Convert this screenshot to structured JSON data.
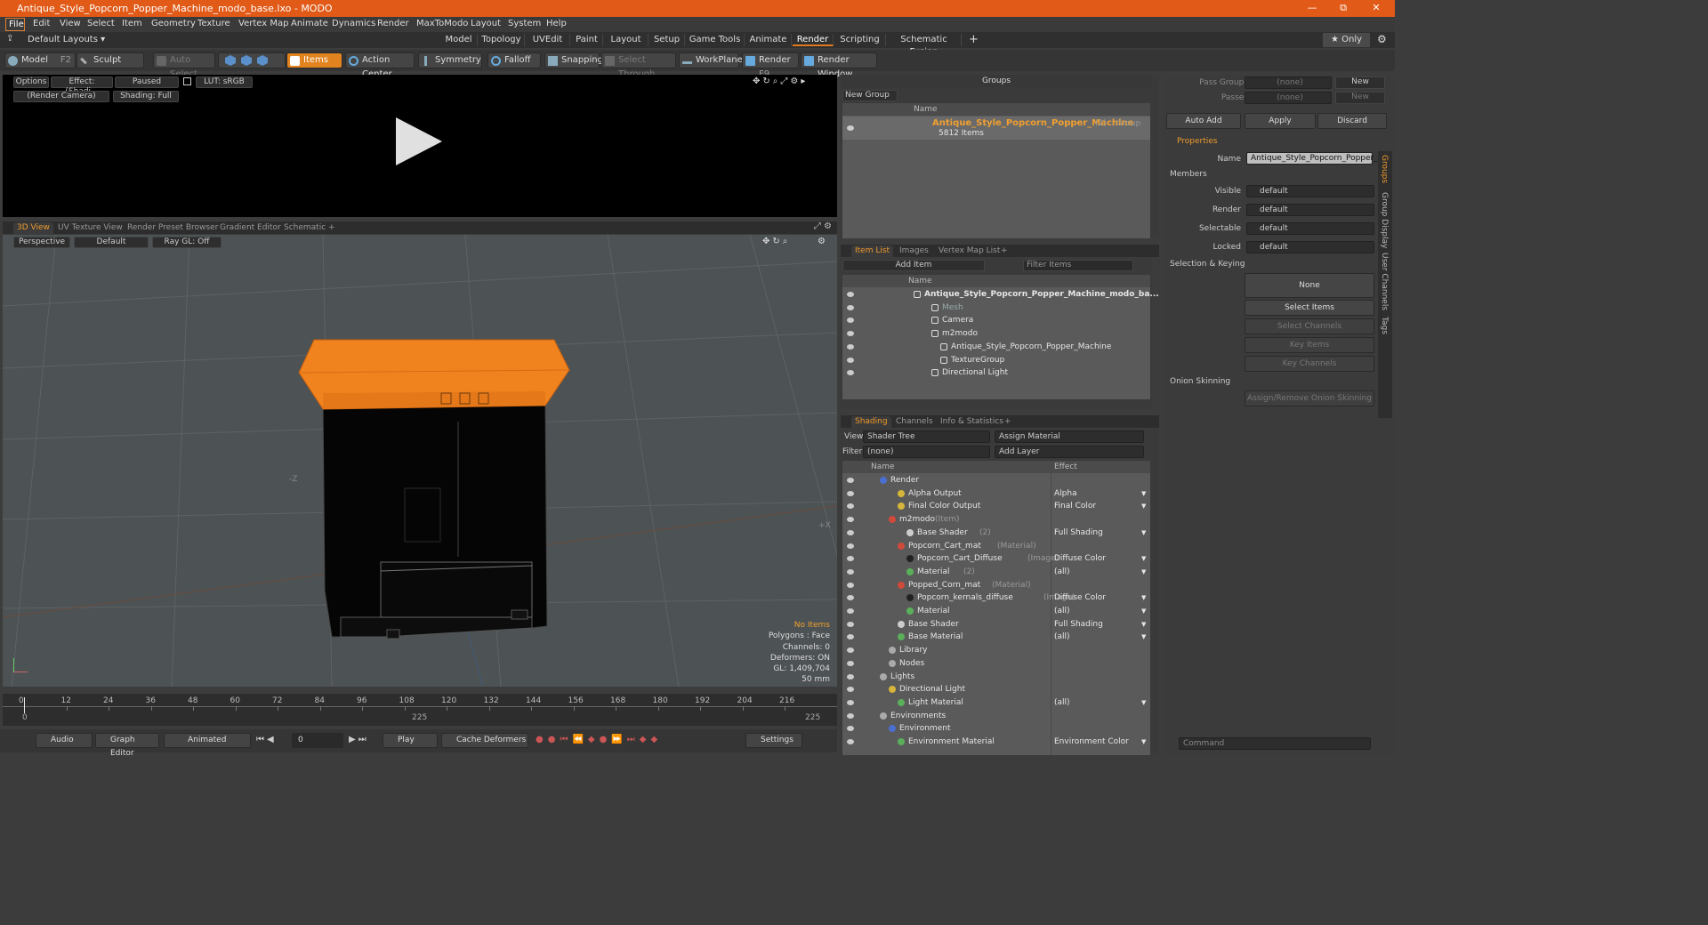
{
  "window": {
    "title": "Antique_Style_Popcorn_Popper_Machine_modo_base.lxo - MODO",
    "controls": [
      "—",
      "⧉",
      "✕"
    ]
  },
  "menu": [
    "File",
    "Edit",
    "View",
    "Select",
    "Item",
    "Geometry",
    "Texture",
    "Vertex Map",
    "Animate",
    "Dynamics",
    "Render",
    "MaxToModo",
    "Layout",
    "System",
    "Help"
  ],
  "layouts": {
    "dropdown": "Default Layouts ▾",
    "tabs": [
      "Model",
      "Topology",
      "UVEdit",
      "Paint",
      "Layout",
      "Setup",
      "Game Tools",
      "Animate",
      "Render",
      "Scripting",
      "Schematic Fusion"
    ],
    "active": "Render",
    "only": "★ Only"
  },
  "toolbar": {
    "model": "Model",
    "model_key": "F2",
    "sculpt": "Sculpt",
    "auto_select": "Auto Select",
    "items": "Items",
    "action_center": "Action Center",
    "symmetry": "Symmetry",
    "falloff": "Falloff",
    "snapping": "Snapping",
    "select_through": "Select Through",
    "workplane": "WorkPlane",
    "render": "Render",
    "render_key": "F9",
    "render_window": "Render Window"
  },
  "render_view": {
    "options": "Options",
    "effect": "Effect: (Shadi...",
    "paused": "Paused",
    "lut": "LUT: sRGB",
    "camera": "(Render Camera)",
    "shading": "Shading: Full"
  },
  "viewport_tabs": [
    "3D View",
    "UV Texture View",
    "Render Preset Browser",
    "Gradient Editor",
    "Schematic"
  ],
  "viewport": {
    "projection": "Perspective",
    "style": "Default",
    "raygl": "Ray GL: Off",
    "axis_z": "-Z",
    "axis_x": "+X",
    "info": {
      "items": "No Items",
      "polygons": "Polygons : Face",
      "channels": "Channels: 0",
      "deformers": "Deformers: ON",
      "gl": "GL: 1,409,704",
      "lens": "50 mm"
    }
  },
  "timeline": {
    "ticks": [
      "0",
      "12",
      "24",
      "36",
      "48",
      "60",
      "72",
      "84",
      "96",
      "108",
      "120",
      "132",
      "144",
      "156",
      "168",
      "180",
      "192",
      "204",
      "216"
    ],
    "start": "0",
    "mid": "225",
    "end": "225"
  },
  "bottombar": {
    "audio": "Audio",
    "graph_editor": "Graph Editor",
    "animated": "Animated",
    "frame": "0",
    "play": "Play",
    "cache": "Cache Deformers",
    "settings": "Settings"
  },
  "groups": {
    "title": "Groups",
    "new_group": "New Group",
    "col_name": "Name",
    "item_name": "Antique_Style_Popcorn_Popper_Machine",
    "item_count": "(2)",
    "item_type": ": Group",
    "item_sub": "5812 Items"
  },
  "item_list": {
    "tabs": [
      "Item List",
      "Images",
      "Vertex Map List"
    ],
    "add_item": "Add Item",
    "filter": "Filter Items",
    "col_name": "Name",
    "rows": [
      {
        "label": "Antique_Style_Popcorn_Popper_Machine_modo_ba...",
        "indent": 0,
        "bold": true,
        "dim": false
      },
      {
        "label": "Mesh",
        "indent": 2,
        "bold": false,
        "dim": true
      },
      {
        "label": "Camera",
        "indent": 2,
        "bold": false,
        "dim": false
      },
      {
        "label": "m2modo",
        "indent": 2,
        "bold": false,
        "dim": false
      },
      {
        "label": "Antique_Style_Popcorn_Popper_Machine",
        "indent": 3,
        "bold": false,
        "dim": false
      },
      {
        "label": "TextureGroup",
        "indent": 3,
        "bold": false,
        "dim": false
      },
      {
        "label": "Directional Light",
        "indent": 2,
        "bold": false,
        "dim": false
      }
    ]
  },
  "shading": {
    "tabs": [
      "Shading",
      "Channels",
      "Info & Statistics"
    ],
    "view_label": "View",
    "view_value": "Shader Tree",
    "assign": "Assign Material",
    "filter_label": "Filter",
    "filter_value": "(none)",
    "add_layer": "Add Layer",
    "col_name": "Name",
    "col_effect": "Effect",
    "rows": [
      {
        "name": "Render",
        "suffix": "",
        "effect": "",
        "indent": 0
      },
      {
        "name": "Alpha Output",
        "suffix": "",
        "effect": "Alpha",
        "indent": 2
      },
      {
        "name": "Final Color Output",
        "suffix": "",
        "effect": "Final Color",
        "indent": 2
      },
      {
        "name": "m2modo",
        "suffix": "(Item)",
        "effect": "",
        "indent": 1
      },
      {
        "name": "Base Shader",
        "suffix": "(2)",
        "effect": "Full Shading",
        "indent": 3
      },
      {
        "name": "Popcorn_Cart_mat",
        "suffix": "(Material)",
        "effect": "",
        "indent": 2
      },
      {
        "name": "Popcorn_Cart_Diffuse",
        "suffix": "(Image)",
        "effect": "Diffuse Color",
        "indent": 3
      },
      {
        "name": "Material",
        "suffix": "(2)",
        "effect": "(all)",
        "indent": 3
      },
      {
        "name": "Popped_Corn_mat",
        "suffix": "(Material)",
        "effect": "",
        "indent": 2
      },
      {
        "name": "Popcorn_kernals_diffuse",
        "suffix": "(Image)",
        "effect": "Diffuse Color",
        "indent": 3
      },
      {
        "name": "Material",
        "suffix": "",
        "effect": "(all)",
        "indent": 3
      },
      {
        "name": "Base Shader",
        "suffix": "",
        "effect": "Full Shading",
        "indent": 2
      },
      {
        "name": "Base Material",
        "suffix": "",
        "effect": "(all)",
        "indent": 2
      },
      {
        "name": "Library",
        "suffix": "",
        "effect": "",
        "indent": 1
      },
      {
        "name": "Nodes",
        "suffix": "",
        "effect": "",
        "indent": 1
      },
      {
        "name": "Lights",
        "suffix": "",
        "effect": "",
        "indent": 0
      },
      {
        "name": "Directional Light",
        "suffix": "",
        "effect": "",
        "indent": 1
      },
      {
        "name": "Light Material",
        "suffix": "",
        "effect": "(all)",
        "indent": 2
      },
      {
        "name": "Environments",
        "suffix": "",
        "effect": "",
        "indent": 0
      },
      {
        "name": "Environment",
        "suffix": "",
        "effect": "",
        "indent": 1
      },
      {
        "name": "Environment Material",
        "suffix": "",
        "effect": "Environment Color",
        "indent": 2
      }
    ]
  },
  "properties": {
    "pass_groups_label": "Pass Groups",
    "pass_groups_value": "(none)",
    "passes_label": "Passes",
    "passes_value": "(none)",
    "new1": "New",
    "new2": "New",
    "auto_add": "Auto Add",
    "apply": "Apply",
    "discard": "Discard",
    "tab": "Properties",
    "name_label": "Name",
    "name_value": "Antique_Style_Popcorn_Popper_M",
    "members": "Members",
    "fields": [
      {
        "label": "Visible",
        "value": "default"
      },
      {
        "label": "Render",
        "value": "default"
      },
      {
        "label": "Selectable",
        "value": "default"
      },
      {
        "label": "Locked",
        "value": "default"
      }
    ],
    "sel_keying": "Selection & Keying",
    "none": "None",
    "select_items": "Select Items",
    "select_channels": "Select Channels",
    "key_items": "Key Items",
    "key_channels": "Key Channels",
    "onion": "Onion Skinning",
    "assign_onion": "Assign/Remove Onion Skinning",
    "side_tabs": [
      "Groups",
      "Group Display",
      "User Channels",
      "Tags"
    ],
    "command": "Command"
  },
  "colors": {
    "accent": "#e1831f",
    "title": "#e15a17",
    "viewport_bg": "#4d5254",
    "model": "#f0831e"
  }
}
